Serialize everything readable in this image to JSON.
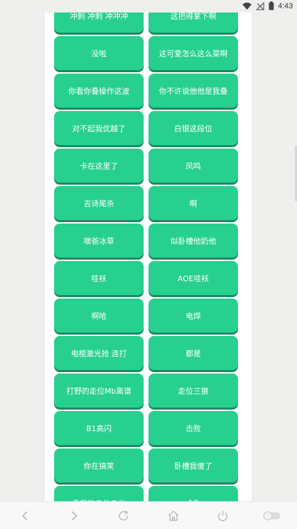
{
  "status_bar": {
    "time": "4:43",
    "icons": [
      "wifi-icon",
      "signal-blocked-icon",
      "battery-icon"
    ]
  },
  "buttons": [
    {
      "label": "冲刺 冲刺 冲冲冲"
    },
    {
      "label": "这把得掌下啊"
    },
    {
      "label": "没啦"
    },
    {
      "label": "这可爱怎么这么菜啊"
    },
    {
      "label": "你看你叠操作这波"
    },
    {
      "label": "你不许说他他是我叠"
    },
    {
      "label": "对不起我优越了"
    },
    {
      "label": "白银这段位"
    },
    {
      "label": "卡在这里了"
    },
    {
      "label": "凤鸣"
    },
    {
      "label": "吉诗尾杀"
    },
    {
      "label": "啊"
    },
    {
      "label": "噢爸冰草"
    },
    {
      "label": "似卧槽他奶他"
    },
    {
      "label": "哇袄"
    },
    {
      "label": "AOE哇袄"
    },
    {
      "label": "啊哈"
    },
    {
      "label": "电焊"
    },
    {
      "label": "电棍激光抢 连打"
    },
    {
      "label": "都是"
    },
    {
      "label": "打野的走位Mb离谱"
    },
    {
      "label": "走位三狼"
    },
    {
      "label": "B1高闪"
    },
    {
      "label": "击败"
    },
    {
      "label": "你在搞笑"
    },
    {
      "label": "卧槽我傻了"
    },
    {
      "label": "看我的走位走位"
    },
    {
      "label": "AO"
    }
  ],
  "nav_bar": {
    "icons": [
      "back-icon",
      "forward-icon",
      "refresh-icon",
      "home-icon",
      "power-icon",
      "toggle-icon"
    ]
  },
  "colors": {
    "button": "#27d08f",
    "button_shadow": "#1a8a61",
    "background": "#efefed",
    "card": "#ffffff"
  }
}
